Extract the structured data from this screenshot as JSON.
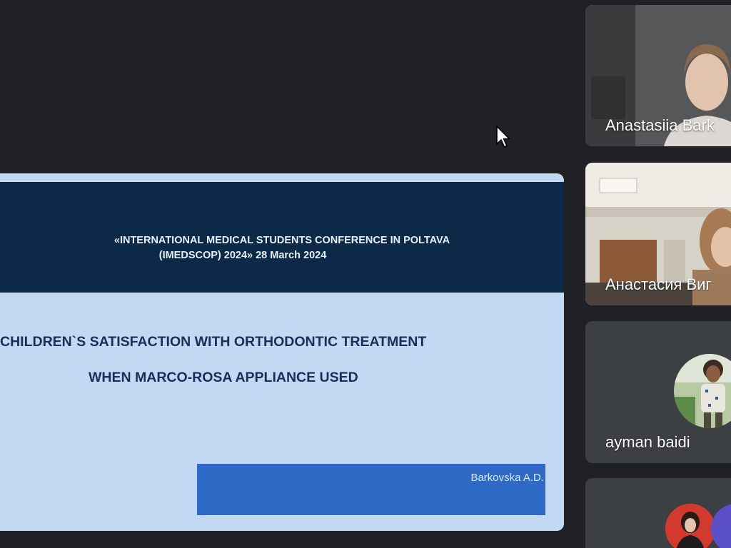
{
  "slide": {
    "conference_line1": "«INTERNATIONAL MEDICAL STUDENTS CONFERENCE IN POLTAVA",
    "conference_line2": "(IMEDSCOP) 2024»  28 March 2024",
    "title_line1": "CHILDREN`S SATISFACTION WITH ORTHODONTIC TREATMENT",
    "title_line2": "WHEN MARCO-ROSA APPLIANCE USED",
    "author": "Barkovska A.D."
  },
  "participants": [
    {
      "name": "Anastasiia Bark",
      "active": true,
      "type": "video"
    },
    {
      "name": "Анастасия Виг",
      "active": false,
      "type": "video"
    },
    {
      "name": "ayman baidi",
      "active": false,
      "type": "avatar"
    },
    {
      "name": "",
      "active": false,
      "type": "avatars"
    }
  ],
  "colors": {
    "background": "#202124",
    "slide_band": "#0c2a48",
    "slide_body": "#c3d9f3",
    "author_box": "#2f6bc6",
    "active_outline": "#8ab4f8"
  }
}
